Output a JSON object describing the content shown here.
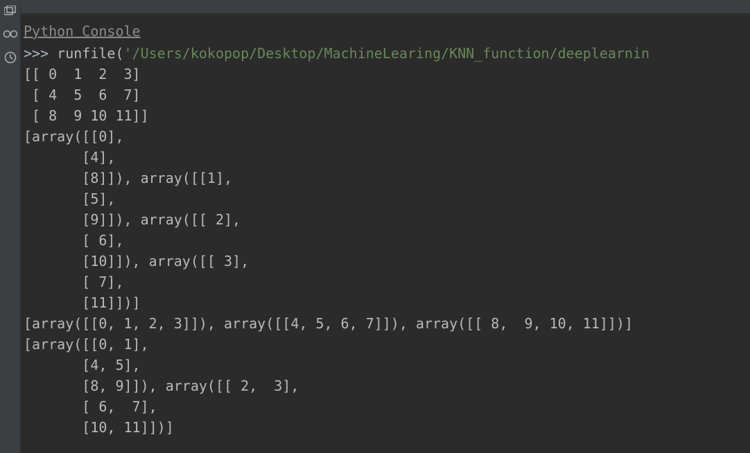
{
  "console": {
    "title": "Python Console",
    "prompt": ">>> ",
    "command_func": "runfile(",
    "command_arg": "'/Users/kokopop/Desktop/MachineLearing/KNN_function/deeplearnin",
    "output_lines": [
      "[[ 0  1  2  3]",
      " [ 4  5  6  7]",
      " [ 8  9 10 11]]",
      "[array([[0],",
      "       [4],",
      "       [8]]), array([[1],",
      "       [5],",
      "       [9]]), array([[ 2],",
      "       [ 6],",
      "       [10]]), array([[ 3],",
      "       [ 7],",
      "       [11]])]",
      "[array([[0, 1, 2, 3]]), array([[4, 5, 6, 7]]), array([[ 8,  9, 10, 11]])]",
      "[array([[0, 1],",
      "       [4, 5],",
      "       [8, 9]]), array([[ 2,  3],",
      "       [ 6,  7],",
      "       [10, 11]])]"
    ]
  }
}
